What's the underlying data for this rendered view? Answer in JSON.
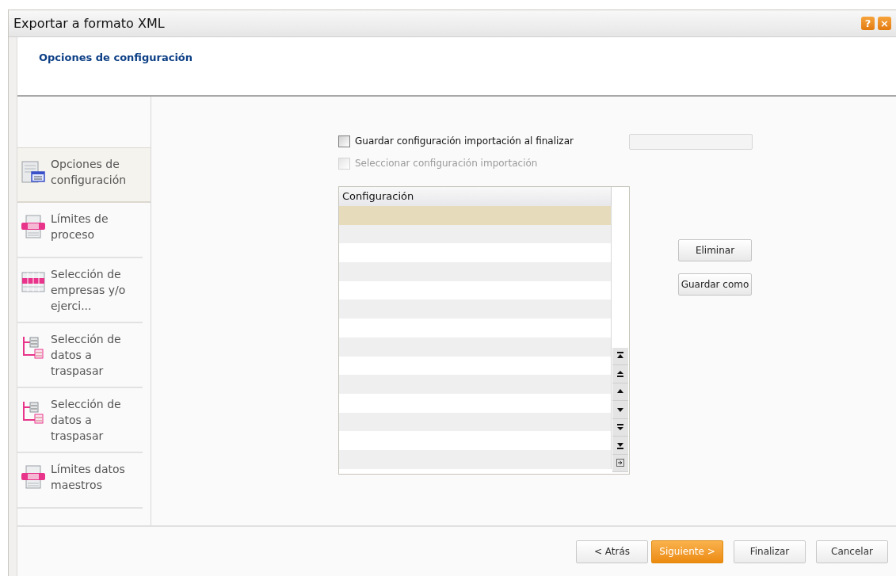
{
  "window": {
    "title": "Exportar a formato XML",
    "buttons": [
      "?",
      "×"
    ]
  },
  "header": {
    "title": "Opciones de configuración"
  },
  "sidebar": {
    "items": [
      {
        "label": "Opciones de configuración",
        "kind": "form",
        "selected": true
      },
      {
        "label": "Límites de proceso",
        "kind": "limits",
        "selected": false
      },
      {
        "label": "Selección de empresas y/o ejerci...",
        "kind": "grid",
        "selected": false
      },
      {
        "label": "Selección de datos a traspasar",
        "kind": "tree",
        "selected": false
      },
      {
        "label": "Selección de datos a traspasar",
        "kind": "tree",
        "selected": false
      },
      {
        "label": "Límites datos maestros",
        "kind": "limits",
        "selected": false
      }
    ]
  },
  "options": [
    {
      "label": "Guardar configuración importación al finalizar",
      "checked": false,
      "disabled": false
    },
    {
      "label": "Seleccionar configuración importación",
      "checked": false,
      "disabled": true
    }
  ],
  "table": {
    "columns": [
      "Configuración"
    ],
    "rows": [
      {
        "selected": true
      },
      {
        "selected": false
      },
      {
        "selected": false
      },
      {
        "selected": false
      },
      {
        "selected": false
      },
      {
        "selected": false
      },
      {
        "selected": false
      },
      {
        "selected": false
      },
      {
        "selected": false
      },
      {
        "selected": false
      },
      {
        "selected": false
      },
      {
        "selected": false
      },
      {
        "selected": false
      },
      {
        "selected": false
      }
    ]
  },
  "side_buttons": [
    "Eliminar",
    "Guardar como"
  ],
  "footer_buttons": [
    {
      "label": "< Atrás",
      "primary": false
    },
    {
      "label": "Siguiente >",
      "primary": true
    },
    {
      "label": "Finalizar",
      "primary": false
    },
    {
      "label": "Cancelar",
      "primary": false
    }
  ]
}
